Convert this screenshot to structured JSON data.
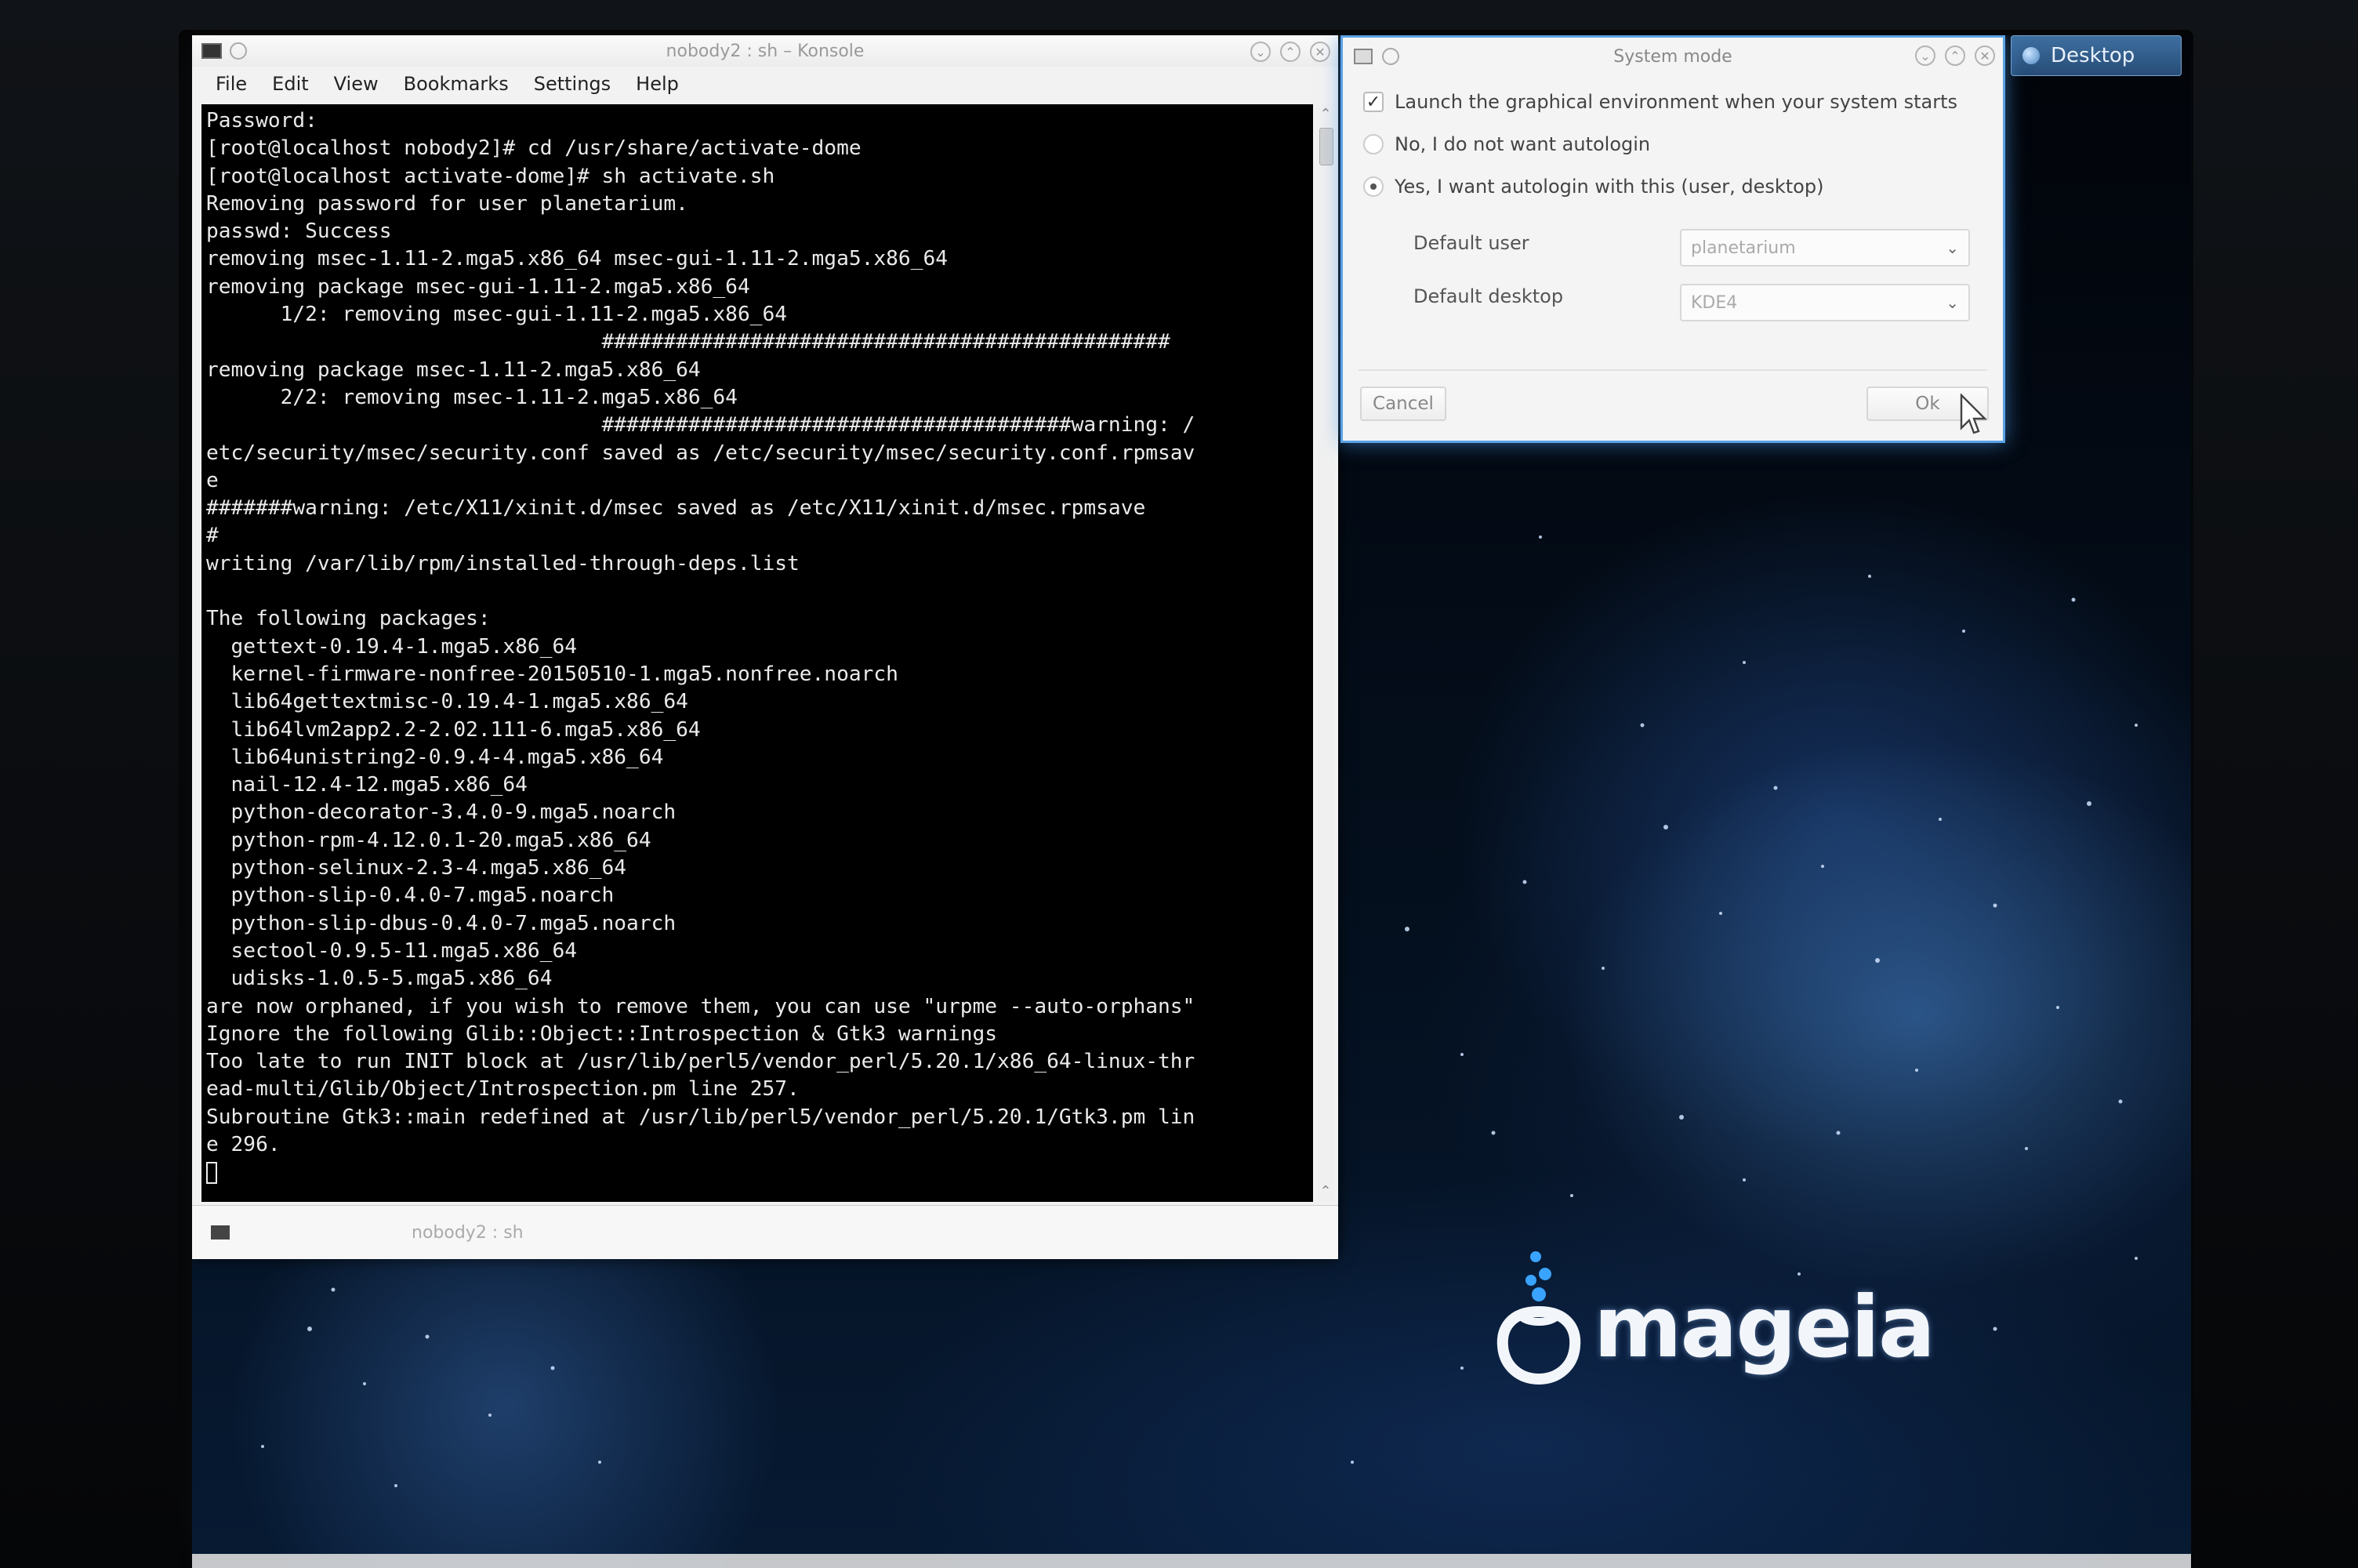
{
  "konsole": {
    "title": "nobody2 : sh – Konsole",
    "menu": [
      "File",
      "Edit",
      "View",
      "Bookmarks",
      "Settings",
      "Help"
    ],
    "terminal_text": "Password:\n[root@localhost nobody2]# cd /usr/share/activate-dome\n[root@localhost activate-dome]# sh activate.sh\nRemoving password for user planetarium.\npasswd: Success\nremoving msec-1.11-2.mga5.x86_64 msec-gui-1.11-2.mga5.x86_64\nremoving package msec-gui-1.11-2.mga5.x86_64\n      1/2: removing msec-gui-1.11-2.mga5.x86_64\n                                ##############################################\nremoving package msec-1.11-2.mga5.x86_64\n      2/2: removing msec-1.11-2.mga5.x86_64\n                                ######################################warning: /\netc/security/msec/security.conf saved as /etc/security/msec/security.conf.rpmsav\ne\n#######warning: /etc/X11/xinit.d/msec saved as /etc/X11/xinit.d/msec.rpmsave\n#\nwriting /var/lib/rpm/installed-through-deps.list\n\nThe following packages:\n  gettext-0.19.4-1.mga5.x86_64\n  kernel-firmware-nonfree-20150510-1.mga5.nonfree.noarch\n  lib64gettextmisc-0.19.4-1.mga5.x86_64\n  lib64lvm2app2.2-2.02.111-6.mga5.x86_64\n  lib64unistring2-0.9.4-4.mga5.x86_64\n  nail-12.4-12.mga5.x86_64\n  python-decorator-3.4.0-9.mga5.noarch\n  python-rpm-4.12.0.1-20.mga5.x86_64\n  python-selinux-2.3-4.mga5.x86_64\n  python-slip-0.4.0-7.mga5.noarch\n  python-slip-dbus-0.4.0-7.mga5.noarch\n  sectool-0.9.5-11.mga5.x86_64\n  udisks-1.0.5-5.mga5.x86_64\nare now orphaned, if you wish to remove them, you can use \"urpme --auto-orphans\"\nIgnore the following Glib::Object::Introspection & Gtk3 warnings\nToo late to run INIT block at /usr/lib/perl5/vendor_perl/5.20.1/x86_64-linux-thr\nead-multi/Glib/Object/Introspection.pm line 257.\nSubroutine Gtk3::main redefined at /usr/lib/perl5/vendor_perl/5.20.1/Gtk3.pm lin\ne 296.\n",
    "tab_label": "nobody2 : sh"
  },
  "dialog": {
    "title": "System mode",
    "launch_label": "Launch the graphical environment when your system starts",
    "launch_checked": true,
    "radio_no_label": "No, I do not want autologin",
    "radio_yes_label": "Yes, I want autologin with this (user, desktop)",
    "selected_radio": "yes",
    "default_user_label": "Default user",
    "default_user_value": "planetarium",
    "default_desktop_label": "Default desktop",
    "default_desktop_value": "KDE4",
    "cancel_label": "Cancel",
    "ok_label": "Ok"
  },
  "desktop": {
    "widget_label": "Desktop",
    "logo_text": "mageia"
  },
  "colors": {
    "dialog_border": "#5aa2e6",
    "terminal_bg": "#000000",
    "terminal_fg": "#eaeaea",
    "desktop_widget": "#3e6fa0"
  }
}
